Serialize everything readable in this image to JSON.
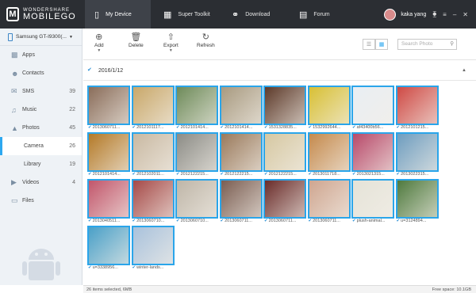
{
  "brand": {
    "line1": "WONDERSHARE",
    "line2": "MOBILEGO",
    "logo_letter": "M"
  },
  "nav": [
    {
      "label": "My Device",
      "icon": "phone-icon",
      "active": true
    },
    {
      "label": "Super Toolkit",
      "icon": "grid-icon"
    },
    {
      "label": "Download",
      "icon": "globe-icon"
    },
    {
      "label": "Forum",
      "icon": "chat-icon"
    }
  ],
  "user": {
    "name": "kaka yang",
    "cart": "⧳",
    "menu": "≡",
    "minimize": "–",
    "close": "✕"
  },
  "device": {
    "name": "Samsung GT-I9300(..."
  },
  "sidebar": [
    {
      "label": "Apps",
      "count": ""
    },
    {
      "label": "Contacts",
      "count": ""
    },
    {
      "label": "SMS",
      "count": "39"
    },
    {
      "label": "Music",
      "count": "22"
    },
    {
      "label": "Photos",
      "count": "45"
    },
    {
      "label": "Camera",
      "count": "26"
    },
    {
      "label": "Library",
      "count": "19"
    },
    {
      "label": "Videos",
      "count": "4"
    },
    {
      "label": "Files",
      "count": ""
    }
  ],
  "toolbar": {
    "add": "Add",
    "delete": "Delete",
    "export": "Export",
    "refresh": "Refresh",
    "search_placeholder": "Search Photo"
  },
  "group": {
    "date": "2016/1/12"
  },
  "photos": [
    {
      "name": "2013060711...",
      "color": "#8a6d5a"
    },
    {
      "name": "2012101117...",
      "color": "#c9a86a"
    },
    {
      "name": "2012101414...",
      "color": "#6e8b5a"
    },
    {
      "name": "2012101414...",
      "color": "#a89a80"
    },
    {
      "name": "1531328835...",
      "color": "#5d3a2a"
    },
    {
      "name": "1532992644...",
      "color": "#d8c035"
    },
    {
      "name": "af43400b56...",
      "color": "#e9eef3"
    },
    {
      "name": "2012101215...",
      "color": "#cf4a45"
    },
    {
      "name": "2012101414...",
      "color": "#b47a28"
    },
    {
      "name": "2012102011...",
      "color": "#c9b9a2"
    },
    {
      "name": "2012122215...",
      "color": "#8c8c86"
    },
    {
      "name": "2012122215...",
      "color": "#9a7a5c"
    },
    {
      "name": "2012122215...",
      "color": "#d6c8a2"
    },
    {
      "name": "2013011718...",
      "color": "#c58a4d"
    },
    {
      "name": "2013021315...",
      "color": "#b84a6a"
    },
    {
      "name": "2013022315...",
      "color": "#6e9dbf"
    },
    {
      "name": "2013040511...",
      "color": "#c2566b"
    },
    {
      "name": "2013060710...",
      "color": "#a64a48"
    },
    {
      "name": "2013060710...",
      "color": "#bfb6a8"
    },
    {
      "name": "2013060711...",
      "color": "#7b5e52"
    },
    {
      "name": "2013060711...",
      "color": "#6a2c2a"
    },
    {
      "name": "2013060711...",
      "color": "#cfa690"
    },
    {
      "name": "plush-animal...",
      "color": "#e5e3d8"
    },
    {
      "name": "u=3124894...",
      "color": "#4f7a3e"
    },
    {
      "name": "u=3338956...",
      "color": "#4aa0c8"
    },
    {
      "name": "winter-lands...",
      "color": "#a9c2dc"
    }
  ],
  "status": {
    "selected": "26 items selected, 6MB",
    "free": "Free space: 10.1GB"
  }
}
